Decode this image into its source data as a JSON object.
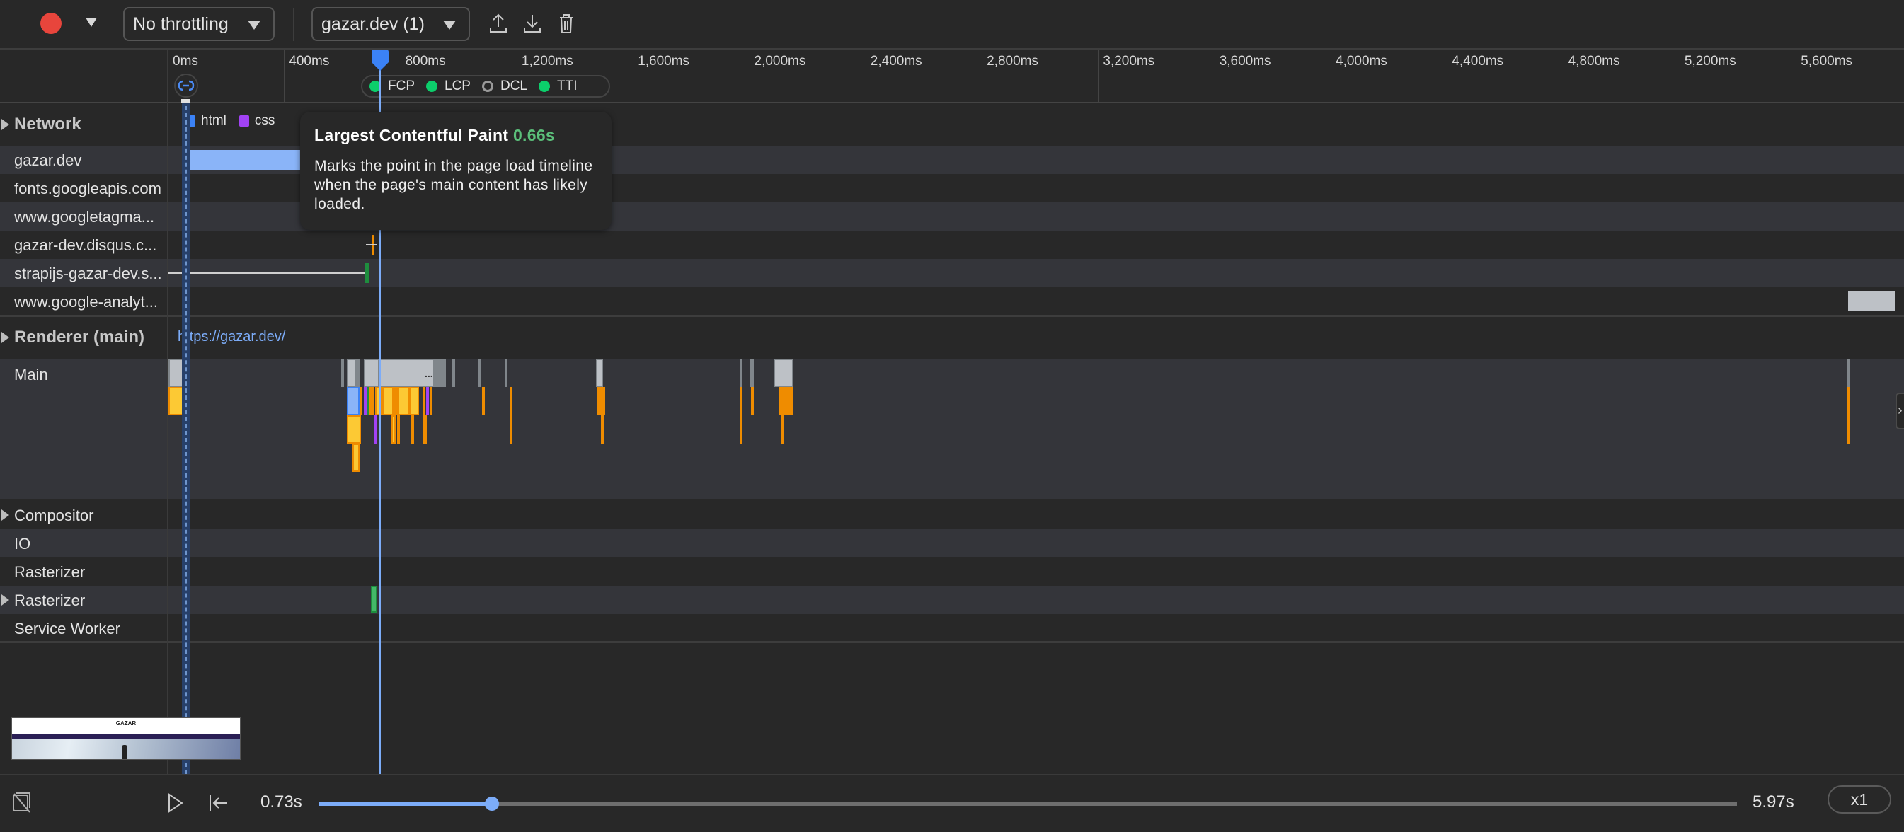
{
  "toolbar": {
    "record_color": "#e8453c",
    "throttling": "No throttling",
    "page_select": "gazar.dev (1)",
    "icons": [
      "upload-icon",
      "download-icon",
      "trash-icon"
    ]
  },
  "ruler": {
    "ticks": [
      "0ms",
      "400ms",
      "800ms",
      "1,200ms",
      "1,600ms",
      "2,000ms",
      "2,400ms",
      "2,800ms",
      "3,200ms",
      "3,600ms",
      "4,000ms",
      "4,400ms",
      "4,800ms",
      "5,200ms",
      "5,600ms"
    ],
    "markers": [
      {
        "label": "FCP",
        "state": "good"
      },
      {
        "label": "LCP",
        "state": "good"
      },
      {
        "label": "DCL",
        "state": "pending"
      },
      {
        "label": "TTI",
        "state": "good"
      }
    ]
  },
  "network": {
    "title": "Network",
    "legend": [
      {
        "label": "html",
        "color": "#3b82f6"
      },
      {
        "label": "css",
        "color": "#a142f4"
      }
    ],
    "rows": [
      {
        "label": "gazar.dev"
      },
      {
        "label": "fonts.googleapis.com"
      },
      {
        "label": "www.googletagma..."
      },
      {
        "label": "gazar-dev.disqus.c..."
      },
      {
        "label": "strapijs-gazar-dev.s..."
      },
      {
        "label": "www.google-analyt..."
      }
    ]
  },
  "renderer": {
    "title": "Renderer (main)",
    "url": "https://gazar.dev/",
    "main_label": "Main"
  },
  "threads": [
    {
      "label": "Compositor",
      "expandable": true
    },
    {
      "label": "IO",
      "expandable": false
    },
    {
      "label": "Rasterizer",
      "expandable": false
    },
    {
      "label": "Rasterizer",
      "expandable": true
    },
    {
      "label": "Service Worker",
      "expandable": false
    }
  ],
  "tooltip": {
    "title": "Largest Contentful Paint",
    "value": "0.66s",
    "body": "Marks the point in the page load timeline when the page's main content has likely loaded."
  },
  "thumbnail": {
    "site_title": "GAZAR"
  },
  "playback": {
    "current": "0.73s",
    "total": "5.97s",
    "speed": "x1",
    "progress": 0.122
  },
  "colors": {
    "accent": "#7cacf8",
    "task_gray": "#bdc1c6",
    "script_yellow": "#fcc934",
    "script_orange": "#ef8c00",
    "render_purple": "#a142f4",
    "paint_green": "#1e8e3e"
  }
}
